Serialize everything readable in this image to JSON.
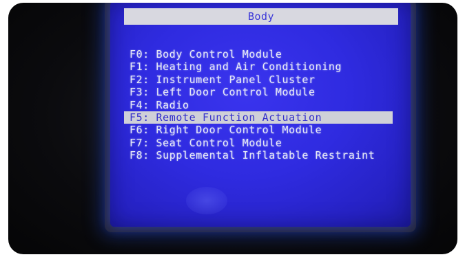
{
  "screen": {
    "title": "Body"
  },
  "menu": {
    "items": [
      {
        "key": "F0",
        "label": "F0: Body Control Module",
        "selected": false
      },
      {
        "key": "F1",
        "label": "F1: Heating and Air Conditioning",
        "selected": false
      },
      {
        "key": "F2",
        "label": "F2: Instrument Panel Cluster",
        "selected": false
      },
      {
        "key": "F3",
        "label": "F3: Left Door Control Module",
        "selected": false
      },
      {
        "key": "F4",
        "label": "F4: Radio",
        "selected": false
      },
      {
        "key": "F5",
        "label": "F5: Remote Function Actuation",
        "selected": true
      },
      {
        "key": "F6",
        "label": "F6: Right Door Control Module",
        "selected": false
      },
      {
        "key": "F7",
        "label": "F7: Seat Control Module",
        "selected": false
      },
      {
        "key": "F8",
        "label": "F8: Supplemental Inflatable Restraint",
        "selected": false
      }
    ]
  },
  "colors": {
    "screen_blue": "#2f2be0",
    "menu_text": "#e6e8f6",
    "highlight_bg": "#cfd0d8",
    "highlight_text": "#3430cc"
  }
}
